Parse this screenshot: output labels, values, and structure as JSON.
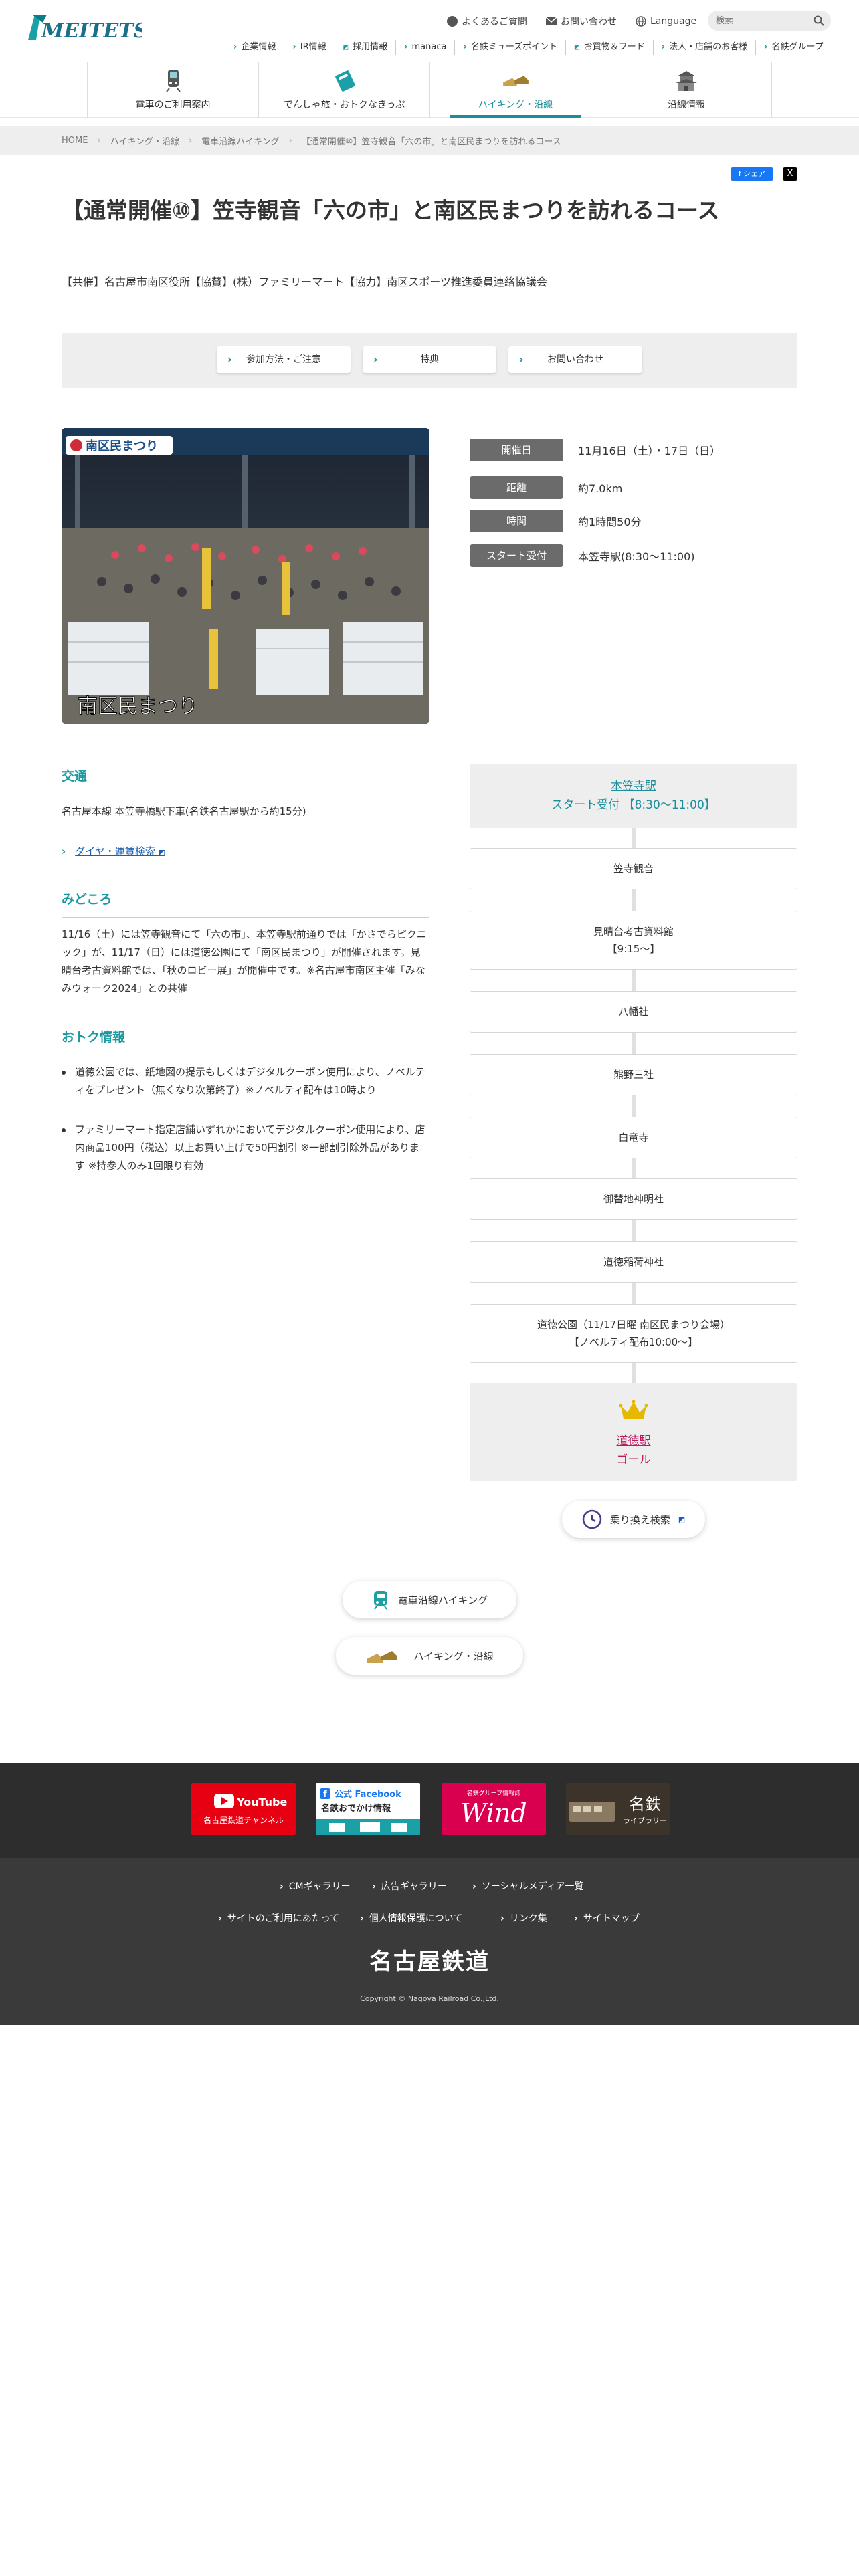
{
  "header": {
    "logo_text": "MEITETSU",
    "utility": {
      "faq": "よくあるご質問",
      "contact": "お問い合わせ",
      "language": "Language"
    },
    "search": {
      "placeholder": "検索"
    },
    "subnav": [
      "企業情報",
      "IR情報",
      "採用情報",
      "manaca",
      "名鉄ミューズポイント",
      "お買物＆フード",
      "法人・店舗のお客様",
      "名鉄グループ"
    ],
    "mainnav": [
      "電車のご利用案内",
      "でんしゃ旅・おトクなきっぷ",
      "ハイキング・沿線",
      "沿線情報"
    ]
  },
  "breadcrumb": [
    "HOME",
    "ハイキング・沿線",
    "電車沿線ハイキング",
    "【通常開催⑩】笠寺観音「六の市」と南区民まつりを訪れるコース"
  ],
  "share": {
    "facebook": "シェア",
    "x": "X"
  },
  "title": "【通常開催⑩】笠寺観音「六の市」と南区民まつりを訪れるコース",
  "organizer": "【共催】名古屋市南区役所【協賛】(株）ファミリーマート【協力】南区スポーツ推進委員連絡協議会",
  "tabs": [
    "参加方法・ご注意",
    "特典",
    "お問い合わせ"
  ],
  "photo": {
    "banner": "南区民まつり",
    "caption": "南区民まつり"
  },
  "info": [
    {
      "label": "開催日",
      "value": "11月16日（土）・17日（日）"
    },
    {
      "label": "距離",
      "value": "約7.0km"
    },
    {
      "label": "時間",
      "value": "約1時間50分"
    },
    {
      "label": "スタート受付",
      "value": "本笠寺駅(8:30〜11:00)"
    }
  ],
  "access": {
    "heading": "交通",
    "text": "名古屋本線 本笠寺橋駅下車(名鉄名古屋駅から約15分)",
    "link": "ダイヤ・運賃検索"
  },
  "highlights": {
    "heading": "みどころ",
    "text": "11/16（土）には笠寺観音にて「六の市」、本笠寺駅前通りでは「かさでらピクニック」が、11/17（日）には道徳公園にて「南区民まつり」が開催されます。見晴台考古資料館では、「秋のロビー展」が開催中です。※名古屋市南区主催「みなみウォーク2024」との共催"
  },
  "deals": {
    "heading": "おトク情報",
    "items": [
      "道徳公園では、紙地図の提示もしくはデジタルクーポン使用により、ノベルティをプレゼント（無くなり次第終了）※ノベルティ配布は10時より",
      "ファミリーマート指定店舗いずれかにおいてデジタルクーポン使用により、店内商品100円（税込）以上お買い上げで50円割引 ※一部割引除外品があります ※持参人のみ1回限り有効"
    ]
  },
  "route": {
    "start_station": "本笠寺駅",
    "start_text": "スタート受付 【8:30〜11:00】",
    "stops": [
      [
        "笠寺観音"
      ],
      [
        "見晴台考古資料館",
        "【9:15〜】"
      ],
      [
        "八幡社"
      ],
      [
        "熊野三社"
      ],
      [
        "白竜寺"
      ],
      [
        "御替地神明社"
      ],
      [
        "道徳稲荷神社"
      ],
      [
        "道徳公園（11/17日曜 南区民まつり会場）",
        "【ノベルティ配布10:00〜】"
      ]
    ],
    "goal_station": "道徳駅",
    "goal_text": "ゴール",
    "transfer_button": "乗り換え検索"
  },
  "bottom_links": [
    "電車沿線ハイキング",
    "ハイキング・沿線"
  ],
  "banners": {
    "youtube": {
      "brand": "YouTube",
      "sub": "名古屋鉄道チャンネル"
    },
    "facebook": {
      "brand": "公式 Facebook",
      "sub": "名鉄おでかけ情報"
    },
    "wind": {
      "sub": "名鉄グループ情報誌",
      "brand": "Wind"
    },
    "library": {
      "brand": "名鉄",
      "sub": "ライブラリー"
    }
  },
  "footer": {
    "row1": [
      "CMギャラリー",
      "広告ギャラリー",
      "ソーシャルメディア一覧"
    ],
    "row2": [
      "サイトのご利用にあたって",
      "個人情報保護について",
      "リンク集",
      "サイトマップ"
    ],
    "logo": "名古屋鉄道",
    "copyright": "Copyright © Nagoya Railroad Co.,Ltd."
  },
  "colors": {
    "accent": "#1a8f9b",
    "goal": "#c0185f",
    "footer_bg": "#3a3a3a"
  }
}
